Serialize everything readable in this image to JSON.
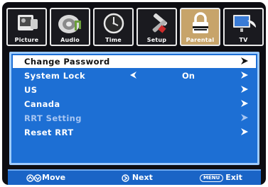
{
  "tabs": [
    {
      "label": "Picture",
      "icon": "picture-icon",
      "active": false
    },
    {
      "label": "Audio",
      "icon": "audio-icon",
      "active": false
    },
    {
      "label": "Time",
      "icon": "clock-icon",
      "active": false
    },
    {
      "label": "Setup",
      "icon": "tools-icon",
      "active": false
    },
    {
      "label": "Parental",
      "icon": "lock-icon",
      "active": true
    },
    {
      "label": "TV",
      "icon": "satellite-icon",
      "active": false
    }
  ],
  "menu": [
    {
      "label": "Change Password",
      "selected": true,
      "disabled": false,
      "value": ""
    },
    {
      "label": "System Lock",
      "selected": false,
      "disabled": false,
      "value": "On"
    },
    {
      "label": "US",
      "selected": false,
      "disabled": false,
      "value": ""
    },
    {
      "label": "Canada",
      "selected": false,
      "disabled": false,
      "value": ""
    },
    {
      "label": "RRT Setting",
      "selected": false,
      "disabled": true,
      "value": ""
    },
    {
      "label": "Reset RRT",
      "selected": false,
      "disabled": false,
      "value": ""
    }
  ],
  "footer": {
    "move": "Move",
    "next": "Next",
    "menu_key": "MENU",
    "exit": "Exit"
  },
  "colors": {
    "panel": "#1d6fd4",
    "panel_border": "#9ecbff",
    "active_tab": "#c7a46a",
    "background": "#0d0d12"
  }
}
